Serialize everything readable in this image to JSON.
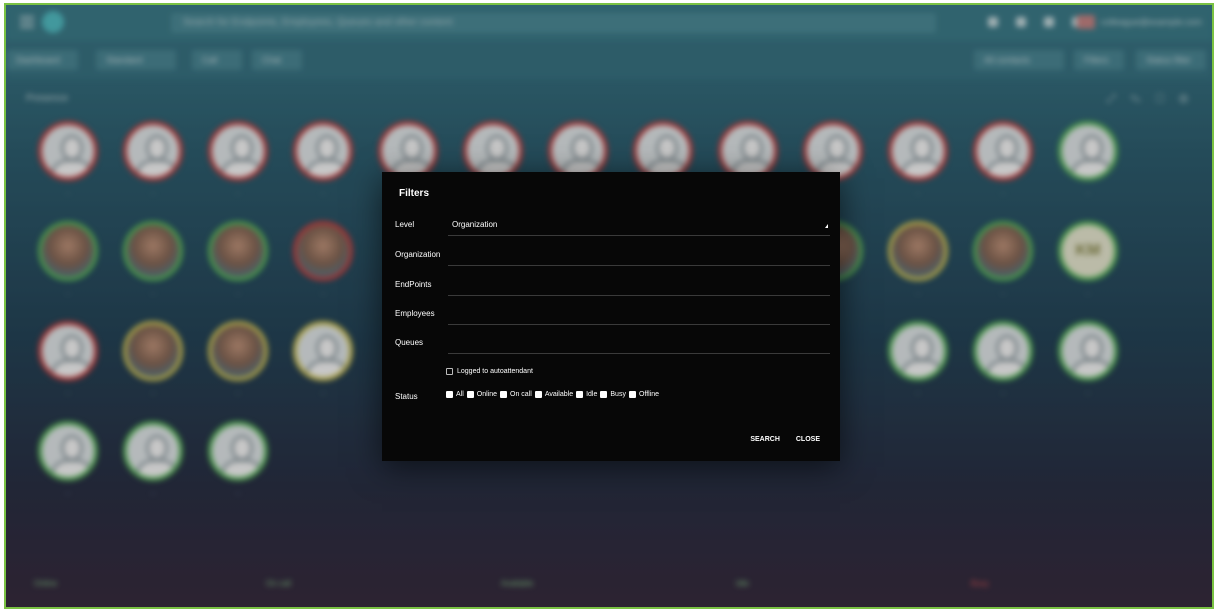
{
  "backdrop": {
    "search_placeholder": "Search for Endpoints, Employees, Queues and other content",
    "toolbar": {
      "dashboard": "Dashboard",
      "btn1": "Standard",
      "btn2": "Call",
      "btn3": "Chat",
      "right1": "All contacts",
      "right2": "Filters",
      "right3": "Status filter"
    },
    "presence_label": "Presence",
    "tools_right": "⤢ ✎ ☐ ⚙",
    "user_name": "colleague@example.com",
    "avatars": [
      {
        "name": "...",
        "ring": "red",
        "kind": "placeholder"
      },
      {
        "name": "...",
        "ring": "red",
        "kind": "placeholder"
      },
      {
        "name": "...",
        "ring": "red",
        "kind": "placeholder"
      },
      {
        "name": "...",
        "ring": "red",
        "kind": "placeholder"
      },
      {
        "name": "...",
        "ring": "red",
        "kind": "placeholder"
      },
      {
        "name": "...",
        "ring": "red",
        "kind": "placeholder"
      },
      {
        "name": "...",
        "ring": "red",
        "kind": "placeholder"
      },
      {
        "name": "...",
        "ring": "red",
        "kind": "placeholder"
      },
      {
        "name": "...",
        "ring": "red",
        "kind": "placeholder"
      },
      {
        "name": "...",
        "ring": "red",
        "kind": "placeholder"
      },
      {
        "name": "...",
        "ring": "red",
        "kind": "placeholder"
      },
      {
        "name": "...",
        "ring": "red",
        "kind": "placeholder"
      },
      {
        "name": "...",
        "ring": "green",
        "kind": "placeholder"
      },
      {
        "name": "...",
        "ring": "green",
        "kind": "photo"
      },
      {
        "name": "...",
        "ring": "green",
        "kind": "photo"
      },
      {
        "name": "...",
        "ring": "green",
        "kind": "photo"
      },
      {
        "name": "...",
        "ring": "red",
        "kind": "photo"
      },
      {
        "name": "...",
        "ring": "green",
        "kind": "photo"
      },
      {
        "name": "...",
        "ring": "yellow",
        "kind": "photo"
      },
      {
        "name": "...",
        "ring": "green",
        "kind": "photo"
      },
      {
        "name": "...",
        "ring": "green",
        "kind": "initials",
        "initials": "KM"
      },
      {
        "name": "...",
        "ring": "red",
        "kind": "placeholder"
      },
      {
        "name": "...",
        "ring": "yellow",
        "kind": "photo"
      },
      {
        "name": "...",
        "ring": "yellow",
        "kind": "photo"
      },
      {
        "name": "...",
        "ring": "yellow",
        "kind": "placeholder"
      },
      {
        "name": "...",
        "ring": "green",
        "kind": "placeholder"
      },
      {
        "name": "...",
        "ring": "green",
        "kind": "placeholder"
      },
      {
        "name": "...",
        "ring": "green",
        "kind": "placeholder"
      },
      {
        "name": "...",
        "ring": "green",
        "kind": "placeholder"
      },
      {
        "name": "...",
        "ring": "green",
        "kind": "placeholder"
      },
      {
        "name": "...",
        "ring": "green",
        "kind": "placeholder"
      }
    ],
    "status_bar": [
      "Online",
      "On call",
      "Available",
      "Idle",
      "Busy"
    ]
  },
  "filters": {
    "title": "Filters",
    "level_label": "Level",
    "level_value": "Organization",
    "organization_label": "Organization",
    "endpoints_label": "EndPoints",
    "employees_label": "Employees",
    "queues_label": "Queues",
    "logged_label": "Logged to autoattendant",
    "status_label": "Status",
    "status_options": [
      "All",
      "Online",
      "On call",
      "Available",
      "Idle",
      "Busy",
      "Offline"
    ],
    "search_btn": "SEARCH",
    "close_btn": "CLOSE"
  },
  "colors": {
    "frame_border": "#7ac243",
    "modal_bg": "#070707",
    "ring_red": "#cc4444",
    "ring_green": "#5fbf5f",
    "ring_yellow": "#d9cc5a"
  }
}
